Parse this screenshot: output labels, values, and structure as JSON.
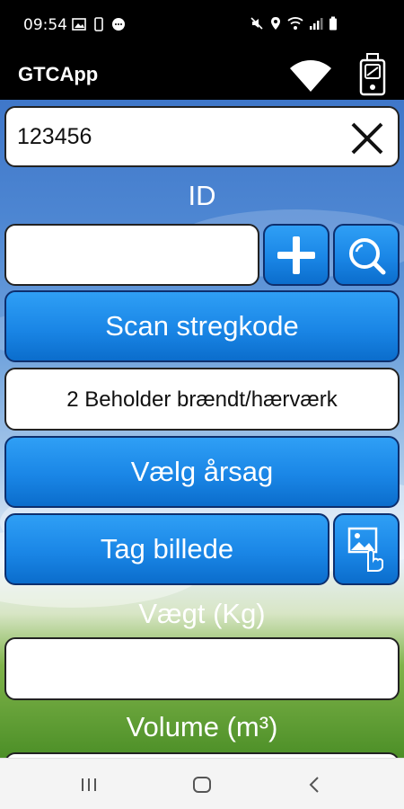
{
  "status_bar": {
    "time": "09:54",
    "left_icons": [
      "image-icon",
      "phone-icon",
      "message-icon"
    ],
    "right_icons": [
      "mute-icon",
      "location-icon",
      "wifi-icon",
      "signal-icon",
      "battery-icon"
    ]
  },
  "app_bar": {
    "title": "GTCApp",
    "icons": [
      "wifi-icon",
      "handheld-device-icon"
    ]
  },
  "form": {
    "search_value": "123456",
    "id_label": "ID",
    "id_value": "",
    "scan_button_label": "Scan stregkode",
    "selected_reason": "2 Beholder brændt/hærværk",
    "choose_reason_label": "Vælg årsag",
    "take_photo_label": "Tag billede",
    "weight_label": "Vægt (Kg)",
    "weight_value": "",
    "volume_label": "Volume (m³)"
  },
  "colors": {
    "button_blue": "#1a86e6",
    "button_border": "#0d2f6e",
    "sky_top": "#3f77c9",
    "grass": "#4c8f27"
  },
  "nav_bar": {
    "icons": [
      "recent-apps-icon",
      "home-icon",
      "back-icon"
    ]
  }
}
